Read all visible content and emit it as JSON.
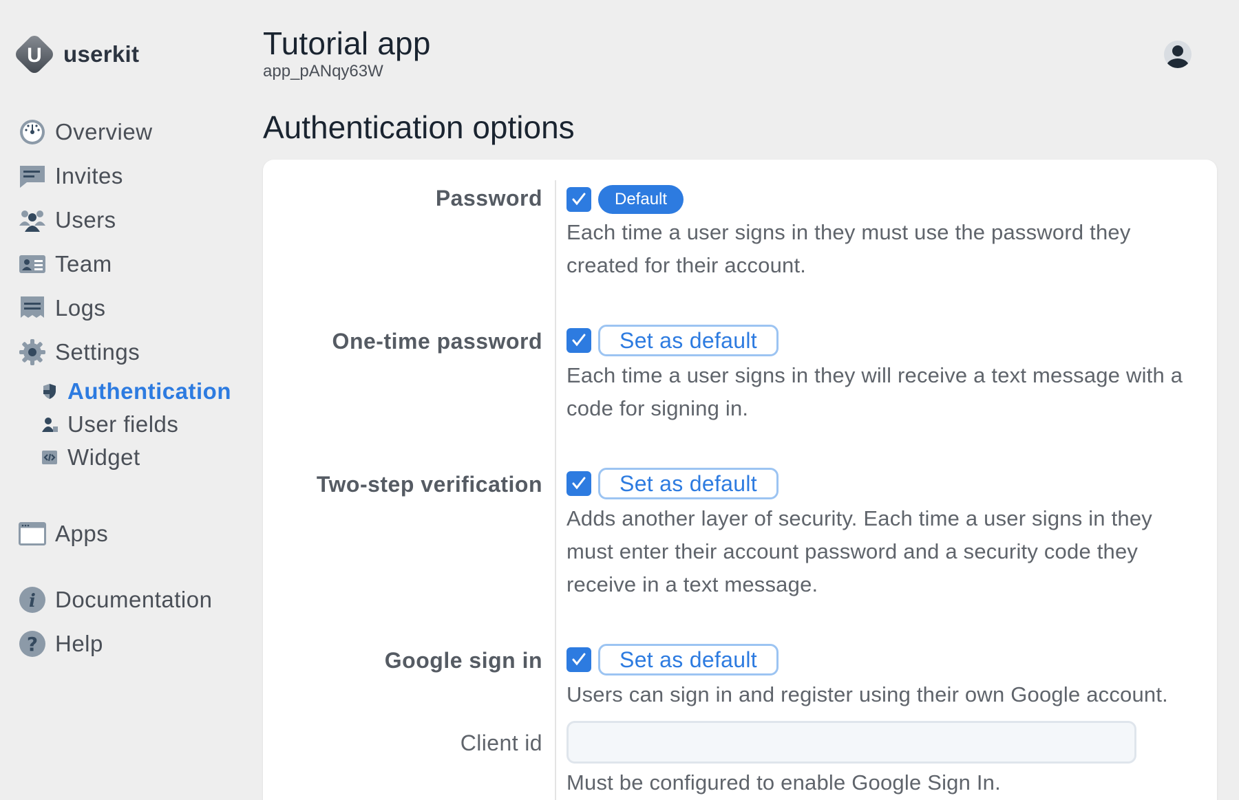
{
  "brand": {
    "name": "userkit",
    "logo_letter": "U"
  },
  "sidebar": {
    "items": [
      {
        "label": "Overview",
        "icon": "dashboard-icon"
      },
      {
        "label": "Invites",
        "icon": "message-icon"
      },
      {
        "label": "Users",
        "icon": "users-icon"
      },
      {
        "label": "Team",
        "icon": "id-card-icon"
      },
      {
        "label": "Logs",
        "icon": "log-icon"
      },
      {
        "label": "Settings",
        "icon": "gear-icon"
      }
    ],
    "sub_items": [
      {
        "label": "Authentication",
        "icon": "shield-icon",
        "active": true
      },
      {
        "label": "User fields",
        "icon": "user-icon",
        "active": false
      },
      {
        "label": "Widget",
        "icon": "code-icon",
        "active": false
      }
    ],
    "apps": {
      "label": "Apps",
      "icon": "window-icon"
    },
    "docs": {
      "label": "Documentation",
      "icon": "info-icon"
    },
    "help": {
      "label": "Help",
      "icon": "question-icon"
    }
  },
  "header": {
    "app_title": "Tutorial app",
    "app_id": "app_pANqy63W",
    "avatar_icon": "account-icon"
  },
  "page": {
    "heading": "Authentication options"
  },
  "options": [
    {
      "label": "Password",
      "checked": true,
      "is_default": true,
      "default_label": "Default",
      "description": "Each time a user signs in they must use the password they created for their account."
    },
    {
      "label": "One-time password",
      "checked": true,
      "is_default": false,
      "button_label": "Set as default",
      "description": "Each time a user signs in they will receive a text message with a code for signing in."
    },
    {
      "label": "Two-step verification",
      "checked": true,
      "is_default": false,
      "button_label": "Set as default",
      "description": "Adds another layer of security. Each time a user signs in they must enter their account password and a security code they receive in a text message."
    },
    {
      "label": "Google sign in",
      "checked": true,
      "is_default": false,
      "button_label": "Set as default",
      "description": "Users can sign in and register using their own Google account."
    }
  ],
  "google_client": {
    "label": "Client id",
    "value": "",
    "placeholder": "",
    "help": "Must be configured to enable Google Sign In."
  },
  "colors": {
    "accent": "#2d7be0",
    "background": "#eeeeee",
    "card": "#ffffff",
    "text_muted": "#5f646b"
  }
}
